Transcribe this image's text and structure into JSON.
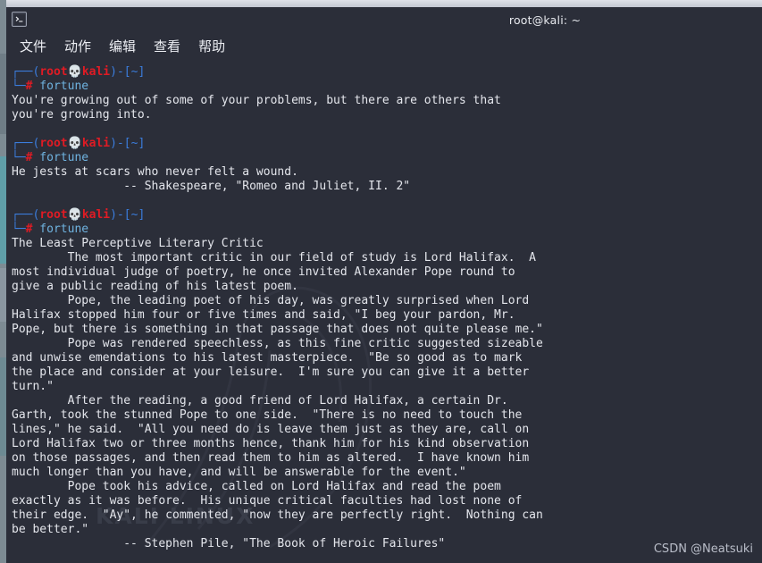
{
  "window": {
    "title": "root@kali: ~",
    "icon": "terminal-icon"
  },
  "menubar": {
    "items": [
      {
        "label": "文件",
        "name": "menu-file"
      },
      {
        "label": "动作",
        "name": "menu-actions"
      },
      {
        "label": "编辑",
        "name": "menu-edit"
      },
      {
        "label": "查看",
        "name": "menu-view"
      },
      {
        "label": "帮助",
        "name": "menu-help"
      }
    ]
  },
  "prompt": {
    "top_left": "┌──(",
    "user": "root",
    "skull": "💀",
    "host": "kali",
    "close_paren": ")-[",
    "path": "~",
    "close_bracket": "]",
    "bottom_left": "└─",
    "hash": "#",
    "command": "fortune"
  },
  "blocks": [
    {
      "command": "fortune",
      "output": "You're growing out of some of your problems, but there are others that\nyou're growing into."
    },
    {
      "command": "fortune",
      "output": "He jests at scars who never felt a wound.\n                -- Shakespeare, \"Romeo and Juliet, II. 2\""
    },
    {
      "command": "fortune",
      "output": "The Least Perceptive Literary Critic\n        The most important critic in our field of study is Lord Halifax.  A\nmost individual judge of poetry, he once invited Alexander Pope round to\ngive a public reading of his latest poem.\n        Pope, the leading poet of his day, was greatly surprised when Lord\nHalifax stopped him four or five times and said, \"I beg your pardon, Mr.\nPope, but there is something in that passage that does not quite please me.\"\n        Pope was rendered speechless, as this fine critic suggested sizeable\nand unwise emendations to his latest masterpiece.  \"Be so good as to mark\nthe place and consider at your leisure.  I'm sure you can give it a better\nturn.\"\n        After the reading, a good friend of Lord Halifax, a certain Dr.\nGarth, took the stunned Pope to one side.  \"There is no need to touch the\nlines,\" he said.  \"All you need do is leave them just as they are, call on\nLord Halifax two or three months hence, thank him for his kind observation\non those passages, and then read them to him as altered.  I have known him\nmuch longer than you have, and will be answerable for the event.\"\n        Pope took his advice, called on Lord Halifax and read the poem\nexactly as it was before.  His unique critical faculties had lost none of\ntheir edge.  \"Ay\", he commented, \"now they are perfectly right.  Nothing can\nbe better.\"\n                -- Stephen Pile, \"The Book of Heroic Failures\""
    }
  ],
  "watermarks": {
    "desktop_brand": "KALI LINUX",
    "csdn": "CSDN @Neatsuki"
  },
  "colors": {
    "background": "#2b2e39",
    "foreground": "#e4e6ec",
    "prompt_blue": "#3b7ddd",
    "prompt_red": "#e01b24",
    "command_blue": "#6fb3e0"
  }
}
